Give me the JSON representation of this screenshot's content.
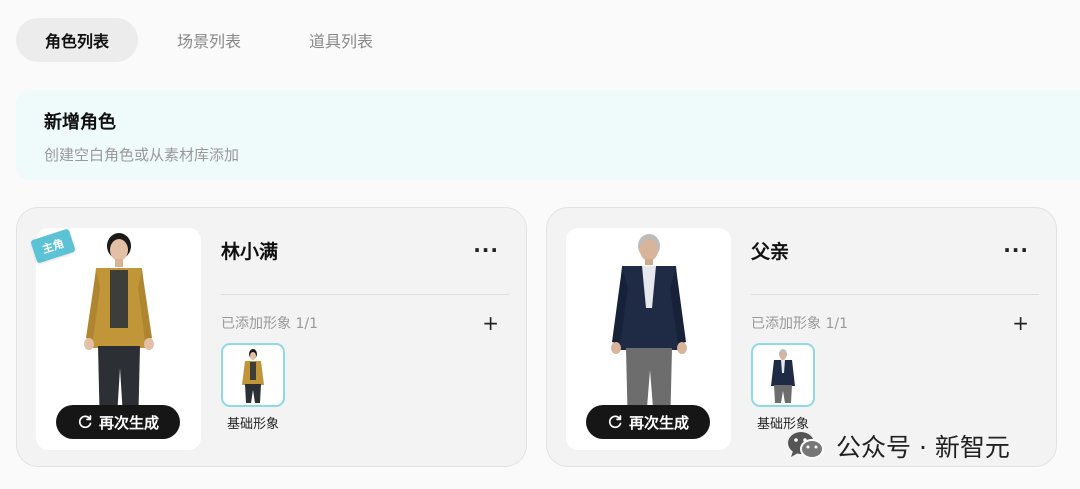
{
  "tabs": [
    {
      "label": "角色列表"
    },
    {
      "label": "场景列表"
    },
    {
      "label": "道具列表"
    }
  ],
  "banner": {
    "title": "新增角色",
    "subtitle": "创建空白角色或从素材库添加"
  },
  "characters": [
    {
      "badge": "主角",
      "name": "林小满",
      "added_text": "已添加形象 1/1",
      "regenerate_label": "再次生成",
      "thumbnail_label": "基础形象",
      "jacket_color": "#c19638"
    },
    {
      "name": "父亲",
      "added_text": "已添加形象 1/1",
      "regenerate_label": "再次生成",
      "thumbnail_label": "基础形象",
      "jacket_color": "#1f2a44"
    }
  ],
  "common": {
    "more_glyph": "···",
    "plus_glyph": "+"
  },
  "watermark": {
    "text": "公众号 · 新智元",
    "icon": "wechat-icon"
  },
  "colors": {
    "accent": "#5cc2d6",
    "banner_bg": "#effafb",
    "regen_bg": "#161616"
  }
}
